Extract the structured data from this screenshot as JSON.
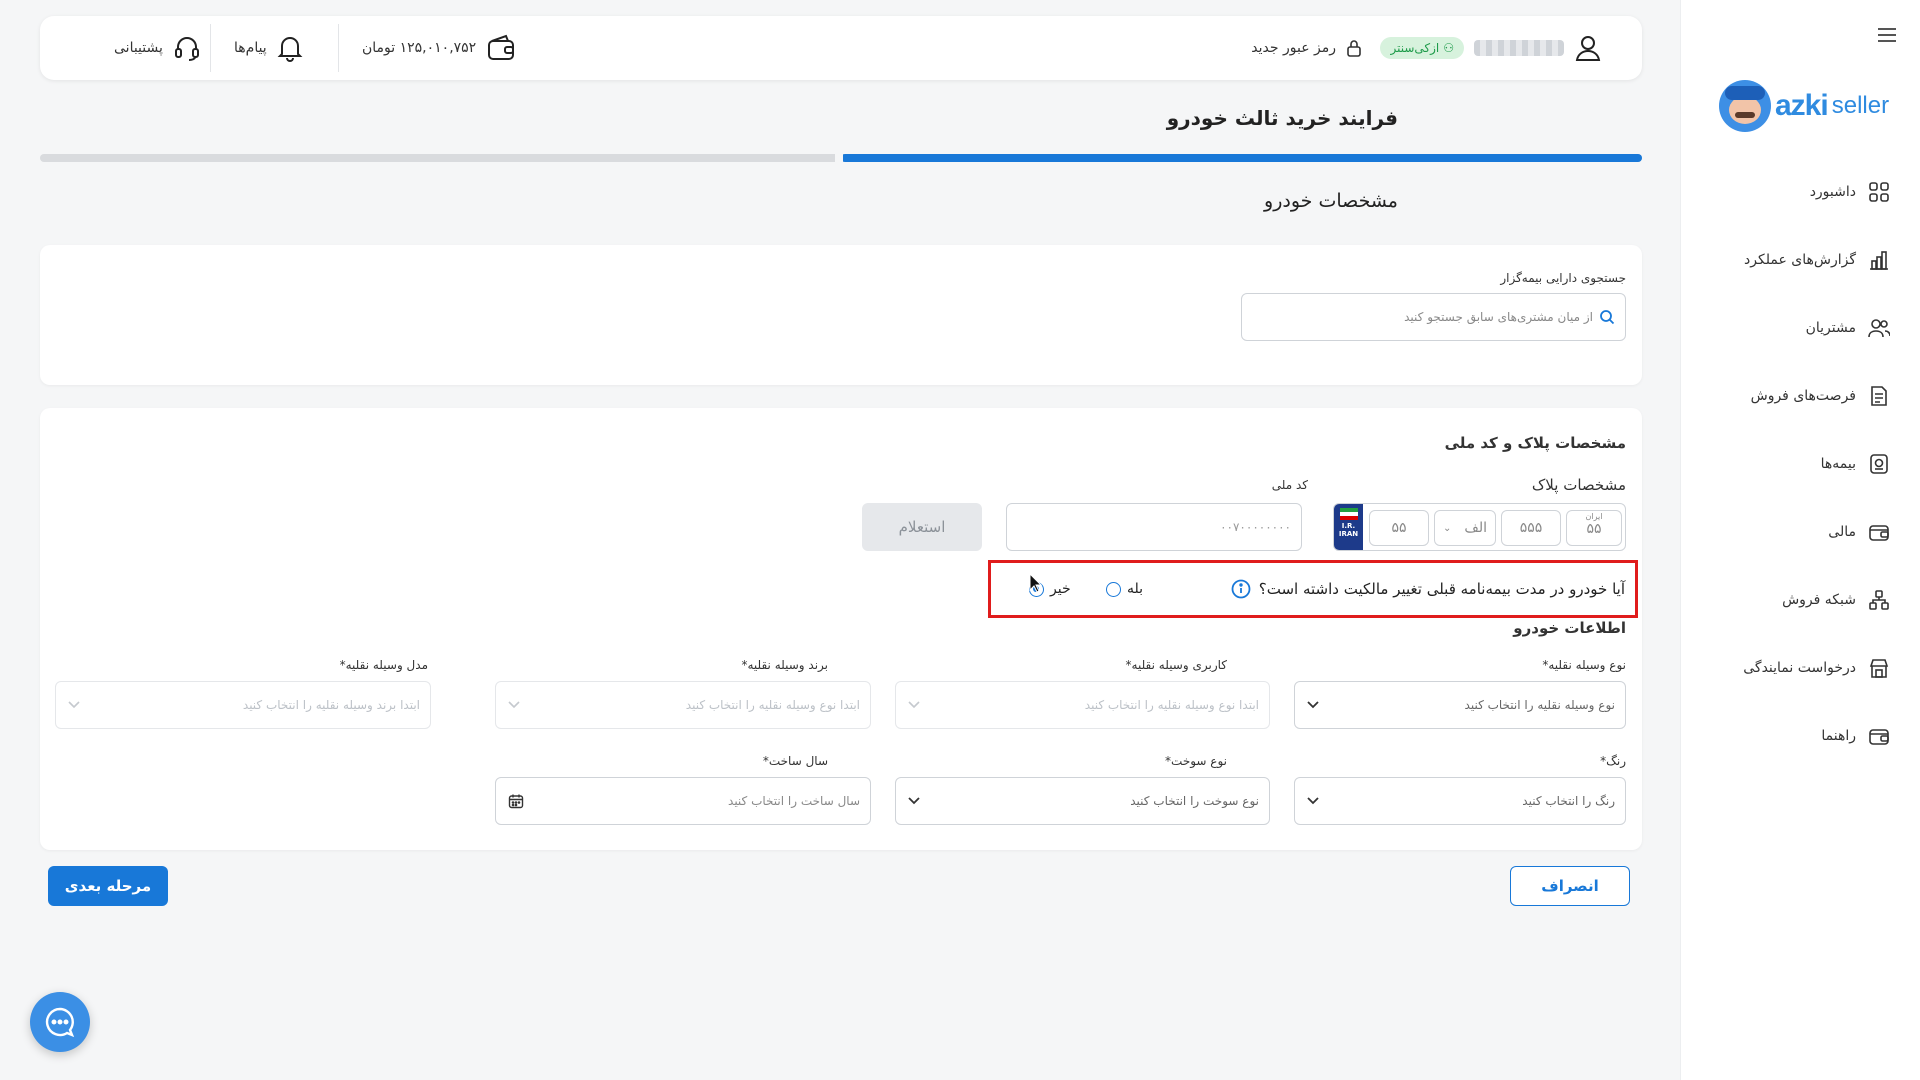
{
  "header": {
    "user_name_masked": "",
    "user_badge": "ازکی‌سنتر",
    "change_password": "رمز عبور جدید",
    "wallet_balance": "۱۲۵,۰۱۰,۷۵۲ تومان",
    "messages": "پیام‌ها",
    "support": "پشتیبانی"
  },
  "page": {
    "title": "فرایند خرید ثالث خودرو",
    "progress_percent": 50,
    "section_title": "مشخصات خودرو"
  },
  "search_card": {
    "label": "جستجوی دارایی بیمه‌گزار",
    "placeholder": "از میان مشتری‌های سابق جستجو کنید"
  },
  "plate_card": {
    "title": "مشخصات پلاک و کد ملی",
    "plate_label": "مشخصات پلاک",
    "plate": {
      "part1": "۵۵",
      "letter": "الف",
      "part2": "۵۵۵",
      "iran_label": "ایران",
      "region": "۵۵",
      "flag_text_1": "I.R.",
      "flag_text_2": "IRAN"
    },
    "national_code_label": "کد ملی",
    "national_code_placeholder": "۰۰۷۰۰۰۰۰۰۰۰",
    "inquiry_button": "استعلام"
  },
  "ownership_question": {
    "text": "آیا خودرو در مدت بیمه‌نامه قبلی تغییر مالکیت داشته است؟",
    "yes": "بله",
    "no": "خیر",
    "selected": "no"
  },
  "vehicle_info": {
    "title": "اطلاعات خودرو",
    "fields_row1": [
      {
        "label": "نوع وسیله نقلیه*",
        "placeholder": "نوع وسیله نقلیه را انتخاب کنید",
        "enabled": true
      },
      {
        "label": "کاربری وسیله نقلیه*",
        "placeholder": "ابتدا نوع وسیله نقلیه را انتخاب کنید",
        "enabled": false
      },
      {
        "label": "برند وسیله نقلیه*",
        "placeholder": "ابتدا نوع وسیله نقلیه را انتخاب کنید",
        "enabled": false
      },
      {
        "label": "مدل وسیله نقلیه*",
        "placeholder": "ابتدا برند وسیله نقلیه را انتخاب کنید",
        "enabled": false
      }
    ],
    "fields_row2": [
      {
        "label": "رنگ*",
        "placeholder": "رنگ را انتخاب کنید"
      },
      {
        "label": "نوع سوخت*",
        "placeholder": "نوع سوخت را انتخاب کنید"
      },
      {
        "label": "سال ساخت*",
        "placeholder": "سال ساخت را انتخاب کنید"
      }
    ]
  },
  "footer": {
    "cancel": "انصراف",
    "next": "مرحله بعدی"
  },
  "sidebar": {
    "logo_word_1": "azki",
    "logo_word_2": "seller",
    "items": [
      {
        "label": "داشبورد",
        "icon": "dashboard-icon"
      },
      {
        "label": "گزارش‌های عملکرد",
        "icon": "chart-icon"
      },
      {
        "label": "مشتریان",
        "icon": "users-icon"
      },
      {
        "label": "فرصت‌های فروش",
        "icon": "document-icon"
      },
      {
        "label": "بیمه‌ها",
        "icon": "insurance-icon"
      },
      {
        "label": "مالی",
        "icon": "wallet-icon"
      },
      {
        "label": "شبکه فروش",
        "icon": "network-icon"
      },
      {
        "label": "درخواست نمایندگی",
        "icon": "store-icon"
      },
      {
        "label": "راهنما",
        "icon": "guide-icon"
      }
    ]
  },
  "colors": {
    "primary": "#1878d8",
    "highlight_border": "#e01c1c",
    "badge_bg": "#d7f2dd",
    "badge_text": "#1e9b4a"
  }
}
